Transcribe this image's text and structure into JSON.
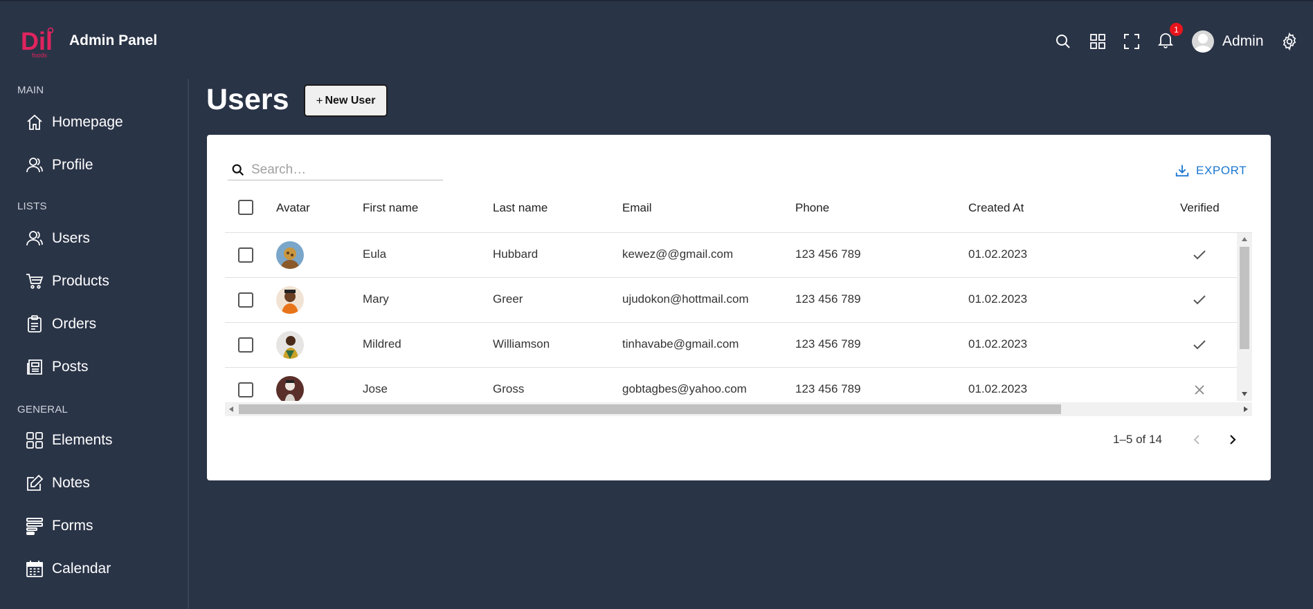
{
  "app": {
    "title": "Admin Panel",
    "logo_text": "Dil foods",
    "user_name": "Admin",
    "notification_count": "1"
  },
  "sidebar": {
    "sections": [
      {
        "title": "MAIN",
        "items": [
          {
            "label": "Homepage",
            "icon": "home-icon"
          },
          {
            "label": "Profile",
            "icon": "profile-icon"
          }
        ]
      },
      {
        "title": "LISTS",
        "items": [
          {
            "label": "Users",
            "icon": "users-icon"
          },
          {
            "label": "Products",
            "icon": "cart-icon"
          },
          {
            "label": "Orders",
            "icon": "clipboard-icon"
          },
          {
            "label": "Posts",
            "icon": "newspaper-icon"
          }
        ]
      },
      {
        "title": "GENERAL",
        "items": [
          {
            "label": "Elements",
            "icon": "grid-icon"
          },
          {
            "label": "Notes",
            "icon": "edit-icon"
          },
          {
            "label": "Forms",
            "icon": "form-icon"
          },
          {
            "label": "Calendar",
            "icon": "calendar-icon"
          }
        ]
      }
    ]
  },
  "page": {
    "title": "Users",
    "new_button": "New User",
    "new_button_plus": "+"
  },
  "table": {
    "search_placeholder": "Search…",
    "export_label": "EXPORT",
    "columns": [
      "Avatar",
      "First name",
      "Last name",
      "Email",
      "Phone",
      "Created At",
      "Verified"
    ],
    "rows": [
      {
        "first": "Eula",
        "last": "Hubbard",
        "email": "kewez@@gmail.com",
        "phone": "123 456 789",
        "created": "01.02.2023",
        "verified": true
      },
      {
        "first": "Mary",
        "last": "Greer",
        "email": "ujudokon@hottmail.com",
        "phone": "123 456 789",
        "created": "01.02.2023",
        "verified": true
      },
      {
        "first": "Mildred",
        "last": "Williamson",
        "email": "tinhavabe@gmail.com",
        "phone": "123 456 789",
        "created": "01.02.2023",
        "verified": true
      },
      {
        "first": "Jose",
        "last": "Gross",
        "email": "gobtagbes@yahoo.com",
        "phone": "123 456 789",
        "created": "01.02.2023",
        "verified": false
      }
    ],
    "pagination": "1–5 of 14"
  },
  "colors": {
    "background": "#2a3447",
    "accent": "#1976d2",
    "logo": "#e0245e",
    "badge": "#e8141c"
  }
}
